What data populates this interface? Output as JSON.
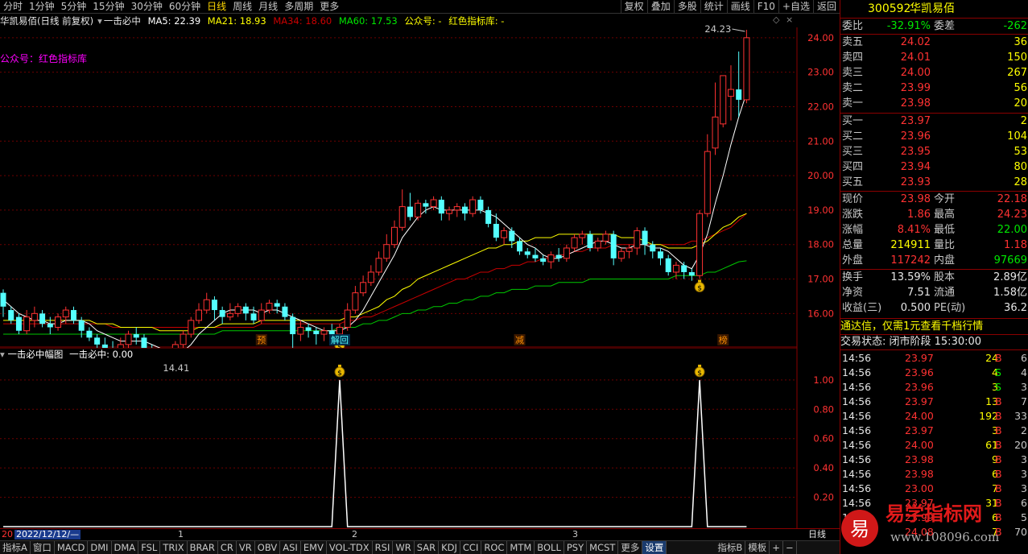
{
  "toolbar": {
    "periods": [
      "分时",
      "1分钟",
      "5分钟",
      "15分钟",
      "30分钟",
      "60分钟",
      "日线",
      "周线",
      "月线",
      "多周期",
      "更多"
    ],
    "active_period": "日线",
    "right": [
      "复权",
      "叠加",
      "多股",
      "统计",
      "画线",
      "F10",
      "+自选",
      "返回"
    ]
  },
  "chart_header": {
    "title": "华凯易佰(日线 前复权)",
    "indicator": "一击必中",
    "ma5": "MA5: 22.39",
    "ma21": "MA21: 18.93",
    "ma34": "MA34: 18.60",
    "ma60": "MA60: 17.53",
    "gzh": "公众号: -",
    "lib": "红色指标库: -"
  },
  "watermark_label": "公众号：红色指标库",
  "colors": {
    "up": "#ff3232",
    "down": "#54ffff",
    "ma5": "#ffffff",
    "ma21": "#ffff00",
    "ma34": "#c80000",
    "ma60": "#00c800",
    "accent": "#ffd700"
  },
  "chart_data": {
    "type": "candlestick",
    "yticks": [
      16,
      17,
      18,
      19,
      20,
      21,
      22,
      23,
      24
    ],
    "ylabels": [
      "16.00",
      "17.00",
      "18.00",
      "19.00",
      "20.00",
      "21.00",
      "22.00",
      "23.00",
      "24.00"
    ],
    "ylim": [
      15.05,
      24.3
    ],
    "high_label": "24.23",
    "low_label": "14.41",
    "candles": [
      [
        16.6,
        16.2,
        16.7,
        15.9
      ],
      [
        16.1,
        15.8,
        16.2,
        15.7
      ],
      [
        15.9,
        15.5,
        16.0,
        15.4
      ],
      [
        15.5,
        15.9,
        16.1,
        15.4
      ],
      [
        15.8,
        16.0,
        16.2,
        15.6
      ],
      [
        16.0,
        15.7,
        16.1,
        15.6
      ],
      [
        15.7,
        15.6,
        15.9,
        15.4
      ],
      [
        15.6,
        15.9,
        16.0,
        15.5
      ],
      [
        15.9,
        16.1,
        16.2,
        15.7
      ],
      [
        16.1,
        15.8,
        16.2,
        15.7
      ],
      [
        15.8,
        15.5,
        15.9,
        15.3
      ],
      [
        15.5,
        15.3,
        15.6,
        15.2
      ],
      [
        15.3,
        15.1,
        15.4,
        14.9
      ],
      [
        15.1,
        15.0,
        15.3,
        14.9
      ],
      [
        15.0,
        14.9,
        15.2,
        14.8
      ],
      [
        14.9,
        15.1,
        15.3,
        14.7
      ],
      [
        15.1,
        15.4,
        15.5,
        15.0
      ],
      [
        15.4,
        15.3,
        15.6,
        15.1
      ],
      [
        15.3,
        15.0,
        15.4,
        14.9
      ],
      [
        15.0,
        14.8,
        15.1,
        14.7
      ],
      [
        14.8,
        14.6,
        14.9,
        14.41
      ],
      [
        14.6,
        14.8,
        15.0,
        14.5
      ],
      [
        14.8,
        15.1,
        15.2,
        14.7
      ],
      [
        15.1,
        15.4,
        15.5,
        15.0
      ],
      [
        15.4,
        15.8,
        15.9,
        15.3
      ],
      [
        15.8,
        16.1,
        16.3,
        15.7
      ],
      [
        16.1,
        16.4,
        16.6,
        16.0
      ],
      [
        16.4,
        16.1,
        16.5,
        15.8
      ],
      [
        16.1,
        15.9,
        16.2,
        15.7
      ],
      [
        15.9,
        16.0,
        16.3,
        15.8
      ],
      [
        16.0,
        16.2,
        16.3,
        15.9
      ],
      [
        16.2,
        16.0,
        16.3,
        15.8
      ],
      [
        16.0,
        15.8,
        16.2,
        15.7
      ],
      [
        15.8,
        16.1,
        16.3,
        15.7
      ],
      [
        16.1,
        16.3,
        16.4,
        16.0
      ],
      [
        16.3,
        16.2,
        16.4,
        16.0
      ],
      [
        16.2,
        15.9,
        16.3,
        15.8
      ],
      [
        15.9,
        15.4,
        16.0,
        14.9
      ],
      [
        15.4,
        15.6,
        15.8,
        15.2
      ],
      [
        15.6,
        15.5,
        15.7,
        15.3
      ],
      [
        15.5,
        15.4,
        15.6,
        15.1
      ],
      [
        15.4,
        15.5,
        15.6,
        15.2
      ],
      [
        15.5,
        15.4,
        15.7,
        15.2
      ],
      [
        15.4,
        15.6,
        15.7,
        15.3
      ],
      [
        15.6,
        16.1,
        16.3,
        15.5
      ],
      [
        16.1,
        16.6,
        16.8,
        16.0
      ],
      [
        16.6,
        16.9,
        17.1,
        16.5
      ],
      [
        16.9,
        17.2,
        17.4,
        16.8
      ],
      [
        17.2,
        17.6,
        17.8,
        17.1
      ],
      [
        17.6,
        18.0,
        18.3,
        17.5
      ],
      [
        18.0,
        18.5,
        18.7,
        17.9
      ],
      [
        18.5,
        19.1,
        19.6,
        18.4
      ],
      [
        19.1,
        18.8,
        19.5,
        18.7
      ],
      [
        18.8,
        19.2,
        19.3,
        18.7
      ],
      [
        19.2,
        19.1,
        19.3,
        18.9
      ],
      [
        19.1,
        19.3,
        19.4,
        19.0
      ],
      [
        19.3,
        18.9,
        19.4,
        18.7
      ],
      [
        18.9,
        19.0,
        19.1,
        18.7
      ],
      [
        19.0,
        19.1,
        19.2,
        18.8
      ],
      [
        19.1,
        18.9,
        19.2,
        18.7
      ],
      [
        18.9,
        19.3,
        19.4,
        18.8
      ],
      [
        19.3,
        19.0,
        19.4,
        18.9
      ],
      [
        19.0,
        18.6,
        19.1,
        18.5
      ],
      [
        18.6,
        18.2,
        18.9,
        18.1
      ],
      [
        18.2,
        18.4,
        18.5,
        18.0
      ],
      [
        18.4,
        18.1,
        18.5,
        17.9
      ],
      [
        18.1,
        17.8,
        18.2,
        17.7
      ],
      [
        17.8,
        17.7,
        17.9,
        17.6
      ],
      [
        17.7,
        17.6,
        17.9,
        17.5
      ],
      [
        17.6,
        17.5,
        17.7,
        17.4
      ],
      [
        17.5,
        17.7,
        17.8,
        17.3
      ],
      [
        17.7,
        17.6,
        17.9,
        17.5
      ],
      [
        17.6,
        17.9,
        18.0,
        17.5
      ],
      [
        17.9,
        18.2,
        18.3,
        17.8
      ],
      [
        18.2,
        18.3,
        18.4,
        18.0
      ],
      [
        18.3,
        17.9,
        18.4,
        17.8
      ],
      [
        17.9,
        18.1,
        18.2,
        17.8
      ],
      [
        18.1,
        18.3,
        18.4,
        18.0
      ],
      [
        18.3,
        17.6,
        18.4,
        17.4
      ],
      [
        17.6,
        17.8,
        17.9,
        17.5
      ],
      [
        17.8,
        17.9,
        18.0,
        17.6
      ],
      [
        17.9,
        18.4,
        18.5,
        17.7
      ],
      [
        18.4,
        18.0,
        18.5,
        17.7
      ],
      [
        18.0,
        17.8,
        18.1,
        17.6
      ],
      [
        17.8,
        17.6,
        17.9,
        17.4
      ],
      [
        17.6,
        17.2,
        17.7,
        17.1
      ],
      [
        17.2,
        17.4,
        17.5,
        17.0
      ],
      [
        17.4,
        17.2,
        17.5,
        17.0
      ],
      [
        17.2,
        17.1,
        17.3,
        16.95
      ],
      [
        17.1,
        18.9,
        19.0,
        17.0
      ],
      [
        18.9,
        20.7,
        21.2,
        18.8
      ],
      [
        20.8,
        21.7,
        22.7,
        20.6
      ],
      [
        21.5,
        22.9,
        22.9,
        21.4
      ],
      [
        22.3,
        22.5,
        23.2,
        21.6
      ],
      [
        22.5,
        22.2,
        23.6,
        21.7
      ],
      [
        22.2,
        24.0,
        24.23,
        22.1
      ]
    ],
    "ma5": [
      16.4,
      16.2,
      16.0,
      15.9,
      15.8,
      15.8,
      15.7,
      15.7,
      15.8,
      15.8,
      15.8,
      15.7,
      15.5,
      15.4,
      15.3,
      15.2,
      15.2,
      15.2,
      15.2,
      15.1,
      15.0,
      14.9,
      14.9,
      14.9,
      15.1,
      15.4,
      15.6,
      15.8,
      16.0,
      16.1,
      16.1,
      16.1,
      16.1,
      16.0,
      16.1,
      16.1,
      16.0,
      15.9,
      15.8,
      15.7,
      15.6,
      15.5,
      15.5,
      15.5,
      15.6,
      15.8,
      16.1,
      16.5,
      16.9,
      17.3,
      17.7,
      18.2,
      18.5,
      18.8,
      19.0,
      19.1,
      19.0,
      19.0,
      19.0,
      19.0,
      19.0,
      19.0,
      18.9,
      18.8,
      18.6,
      18.4,
      18.2,
      18.0,
      17.9,
      17.7,
      17.6,
      17.6,
      17.7,
      17.8,
      17.9,
      18.0,
      18.1,
      18.1,
      18.0,
      17.9,
      17.9,
      18.0,
      18.0,
      17.9,
      17.9,
      17.8,
      17.6,
      17.4,
      17.3,
      17.7,
      18.3,
      19.2,
      20.0,
      20.9,
      21.7,
      22.4
    ],
    "ma21": [
      15.8,
      15.8,
      15.8,
      15.8,
      15.8,
      15.8,
      15.8,
      15.8,
      15.8,
      15.8,
      15.8,
      15.8,
      15.7,
      15.7,
      15.7,
      15.6,
      15.6,
      15.6,
      15.6,
      15.6,
      15.5,
      15.5,
      15.5,
      15.5,
      15.5,
      15.6,
      15.6,
      15.6,
      15.7,
      15.7,
      15.7,
      15.7,
      15.7,
      15.8,
      15.8,
      15.8,
      15.8,
      15.8,
      15.8,
      15.8,
      15.8,
      15.8,
      15.8,
      15.8,
      15.9,
      15.9,
      16.0,
      16.1,
      16.2,
      16.4,
      16.5,
      16.7,
      16.8,
      17.0,
      17.1,
      17.2,
      17.3,
      17.4,
      17.5,
      17.6,
      17.7,
      17.8,
      17.9,
      17.9,
      18.0,
      18.0,
      18.1,
      18.1,
      18.2,
      18.2,
      18.2,
      18.3,
      18.3,
      18.3,
      18.3,
      18.3,
      18.3,
      18.3,
      18.3,
      18.2,
      18.2,
      18.2,
      18.1,
      18.0,
      18.0,
      17.9,
      17.9,
      17.9,
      17.9,
      18.0,
      18.1,
      18.3,
      18.5,
      18.6,
      18.8,
      18.9
    ],
    "ma34": [
      15.7,
      15.7,
      15.7,
      15.7,
      15.7,
      15.7,
      15.7,
      15.7,
      15.7,
      15.7,
      15.7,
      15.7,
      15.7,
      15.7,
      15.6,
      15.6,
      15.6,
      15.6,
      15.6,
      15.6,
      15.6,
      15.6,
      15.6,
      15.6,
      15.6,
      15.6,
      15.6,
      15.6,
      15.6,
      15.6,
      15.6,
      15.6,
      15.6,
      15.7,
      15.7,
      15.7,
      15.7,
      15.7,
      15.7,
      15.7,
      15.7,
      15.7,
      15.7,
      15.7,
      15.8,
      15.8,
      15.9,
      15.9,
      16.0,
      16.1,
      16.2,
      16.3,
      16.4,
      16.5,
      16.6,
      16.7,
      16.8,
      16.9,
      17.0,
      17.0,
      17.1,
      17.2,
      17.2,
      17.3,
      17.3,
      17.4,
      17.4,
      17.5,
      17.5,
      17.6,
      17.6,
      17.7,
      17.7,
      17.8,
      17.8,
      17.9,
      17.9,
      17.9,
      18.0,
      18.0,
      18.0,
      18.0,
      18.0,
      18.0,
      18.0,
      18.0,
      18.0,
      18.0,
      18.1,
      18.1,
      18.2,
      18.3,
      18.4,
      18.5,
      18.7,
      18.9
    ],
    "ma60": [
      15.4,
      15.4,
      15.4,
      15.4,
      15.4,
      15.4,
      15.4,
      15.4,
      15.4,
      15.4,
      15.4,
      15.4,
      15.4,
      15.4,
      15.4,
      15.4,
      15.4,
      15.4,
      15.4,
      15.4,
      15.4,
      15.4,
      15.4,
      15.4,
      15.4,
      15.4,
      15.4,
      15.4,
      15.5,
      15.5,
      15.5,
      15.5,
      15.5,
      15.5,
      15.5,
      15.5,
      15.5,
      15.5,
      15.5,
      15.5,
      15.5,
      15.5,
      15.5,
      15.6,
      15.6,
      15.6,
      15.7,
      15.7,
      15.8,
      15.8,
      15.9,
      16.0,
      16.0,
      16.1,
      16.1,
      16.2,
      16.2,
      16.3,
      16.3,
      16.4,
      16.4,
      16.5,
      16.5,
      16.6,
      16.6,
      16.7,
      16.7,
      16.7,
      16.8,
      16.8,
      16.8,
      16.9,
      16.9,
      16.9,
      16.9,
      17.0,
      17.0,
      17.0,
      17.0,
      17.0,
      17.0,
      17.0,
      17.0,
      17.0,
      17.0,
      17.0,
      17.1,
      17.1,
      17.1,
      17.1,
      17.2,
      17.2,
      17.3,
      17.4,
      17.5,
      17.53
    ],
    "signal_markers": [
      43,
      89
    ],
    "event_labels": [
      {
        "i": 33,
        "text": "预"
      },
      {
        "i": 43,
        "text": "解回"
      },
      {
        "i": 66,
        "text": "减"
      },
      {
        "i": 92,
        "text": "榜"
      }
    ],
    "sub": {
      "title": "一击必中幅图",
      "value_label": "一击必中: 0.00",
      "yticks": [
        0.2,
        0.4,
        0.6,
        0.8,
        1.0
      ],
      "ylabels": [
        "0.20",
        "0.40",
        "0.60",
        "0.80",
        "1.00"
      ],
      "ylim": [
        0,
        1.12
      ]
    }
  },
  "datebar": {
    "start": "20",
    "date": "2022/12/12/—",
    "months": [
      "1",
      "2",
      "3"
    ],
    "period_label": "日线"
  },
  "tabs": [
    "指标A",
    "窗口",
    "MACD",
    "DMI",
    "DMA",
    "FSL",
    "TRIX",
    "BRAR",
    "CR",
    "VR",
    "OBV",
    "ASI",
    "EMV",
    "VOL-TDX",
    "RSI",
    "WR",
    "SAR",
    "KDJ",
    "CCI",
    "ROC",
    "MTM",
    "BOLL",
    "PSY",
    "MCST",
    "更多",
    "设置",
    "指标B",
    "模板",
    "+",
    "−"
  ],
  "active_tab": "设置",
  "quote": {
    "code": "300592",
    "name": "华凯易佰",
    "weibi_label": "委比",
    "weibi": "-32.91%",
    "weicha_label": "委差",
    "weicha": "-262",
    "sell": [
      [
        "卖五",
        "24.02",
        "36"
      ],
      [
        "卖四",
        "24.01",
        "150"
      ],
      [
        "卖三",
        "24.00",
        "267"
      ],
      [
        "卖二",
        "23.99",
        "56"
      ],
      [
        "卖一",
        "23.98",
        "20"
      ]
    ],
    "buy": [
      [
        "买一",
        "23.97",
        "2"
      ],
      [
        "买二",
        "23.96",
        "104"
      ],
      [
        "买三",
        "23.95",
        "53"
      ],
      [
        "买四",
        "23.94",
        "80"
      ],
      [
        "买五",
        "23.93",
        "28"
      ]
    ],
    "stats": [
      [
        "现价",
        "23.98",
        "今开",
        "22.18"
      ],
      [
        "涨跌",
        "1.86",
        "最高",
        "24.23"
      ],
      [
        "涨幅",
        "8.41%",
        "最低",
        "22.00"
      ],
      [
        "总量",
        "214911",
        "量比",
        "1.18"
      ],
      [
        "外盘",
        "117242",
        "内盘",
        "97669"
      ]
    ],
    "stats2": [
      [
        "换手",
        "13.59%",
        "股本",
        "2.89亿"
      ],
      [
        "净资",
        "7.51",
        "流通",
        "1.58亿"
      ],
      [
        "收益(三)",
        "0.500",
        "PE(动)",
        "36.2"
      ]
    ],
    "ad": "通达信，仅需1元查看千档行情",
    "status": "交易状态: 闭市阶段 15:30:00",
    "ticks": [
      [
        "14:56",
        "23.97",
        "24",
        "B",
        "6"
      ],
      [
        "14:56",
        "23.96",
        "4",
        "S",
        "4"
      ],
      [
        "14:56",
        "23.96",
        "3",
        "S",
        "3"
      ],
      [
        "14:56",
        "23.97",
        "13",
        "B",
        "7"
      ],
      [
        "14:56",
        "24.00",
        "192",
        "B",
        "33"
      ],
      [
        "14:56",
        "23.97",
        "3",
        "B",
        "2"
      ],
      [
        "14:56",
        "24.00",
        "61",
        "B",
        "20"
      ],
      [
        "14:56",
        "23.98",
        "9",
        "B",
        "3"
      ],
      [
        "14:56",
        "23.98",
        "6",
        "B",
        "3"
      ],
      [
        "14:56",
        "23.00",
        "7",
        "B",
        "3"
      ],
      [
        "14:56",
        "23.97",
        "31",
        "B",
        "6"
      ],
      [
        "14:56",
        "23.99",
        "6",
        "B",
        "5"
      ],
      [
        "14:57",
        "24.08",
        "7",
        "B",
        "70"
      ]
    ]
  },
  "site_watermark": {
    "brand": "易学指标网",
    "url": "www.108096.com",
    "logo_char": "易"
  }
}
